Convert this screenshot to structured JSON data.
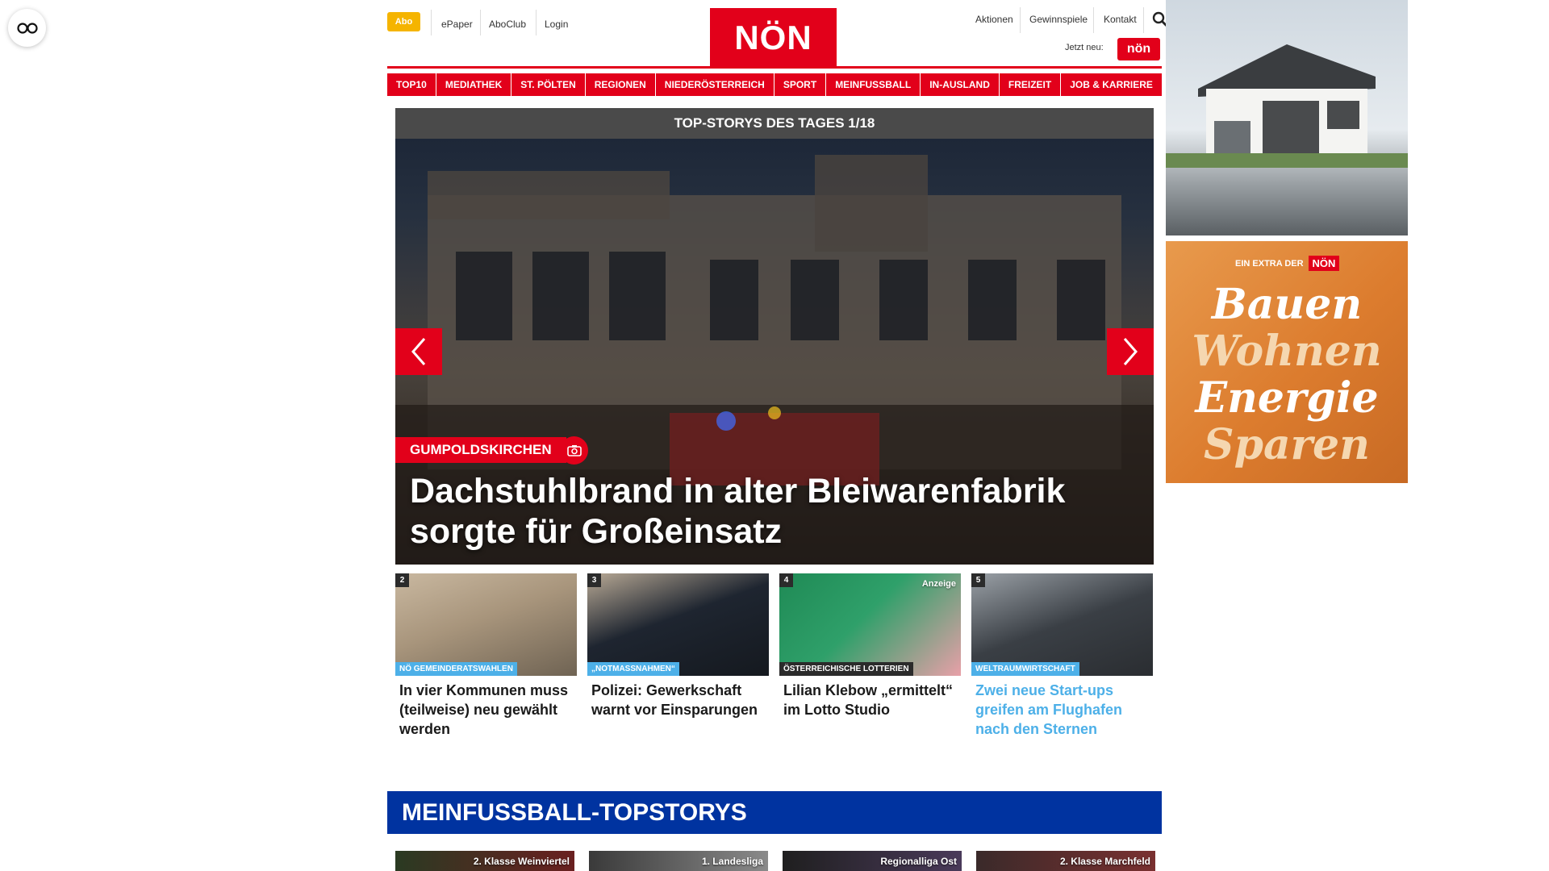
{
  "header": {
    "abo": "Abo",
    "links_left": [
      "ePaper",
      "AboClub",
      "Login"
    ],
    "logo": "NÖN",
    "links_right": [
      "Aktionen",
      "Gewinnspiele",
      "Kontakt"
    ],
    "jetzt_neu": "Jetzt neu:",
    "mini_logo": "nön"
  },
  "nav": [
    "TOP10",
    "MEDIATHEK",
    "ST. PÖLTEN",
    "REGIONEN",
    "NIEDERÖSTERREICH",
    "SPORT",
    "MEINFUSSBALL",
    "IN-AUSLAND",
    "FREIZEIT",
    "JOB & KARRIERE"
  ],
  "hero": {
    "bar_title": "TOP-STORYS DES TAGES 1/18",
    "category": "GUMPOLDSKIRCHEN",
    "title": "Dachstuhlbrand in alter Bleiwarenfabrik sorgte für Großeinsatz"
  },
  "teasers": [
    {
      "num": "2",
      "category": "NÖ GEMEINDERATSWAHLEN",
      "title": "In vier Kommunen muss (teilweise) neu gewählt werden",
      "cat_color": "#4db0e8",
      "title_color": "#1a1a1a"
    },
    {
      "num": "3",
      "category": "„NOTMASSNAHMEN“",
      "title": "Polizei: Gewerkschaft warnt vor Einsparungen",
      "cat_color": "#4db0e8",
      "title_color": "#1a1a1a"
    },
    {
      "num": "4",
      "category": "ÖSTERREICHISCHE LOTTERIEN",
      "title": "Lilian Klebow „ermittelt“ im Lotto Studio",
      "cat_color": "#2b2b2b",
      "title_color": "#1a1a1a",
      "badge": "Anzeige"
    },
    {
      "num": "5",
      "category": "WELTRAUMWIRTSCHAFT",
      "title": "Zwei neue Start-ups greifen am Flughafen nach den Sternen",
      "cat_color": "#4db0e8",
      "title_color": "#4db0e8"
    }
  ],
  "section": {
    "title": "MEINFUSSBALL-TOPSTORYS",
    "cards": [
      "2. Klasse Weinviertel",
      "1. Landesliga",
      "Regionalliga Ost",
      "2. Klasse Marchfeld"
    ]
  },
  "ads": {
    "extra_prefix": "EIN EXTRA DER",
    "extra_logo": "NÖN",
    "words": [
      "Bauen",
      "Wohnen",
      "Energie",
      "Sparen"
    ]
  }
}
